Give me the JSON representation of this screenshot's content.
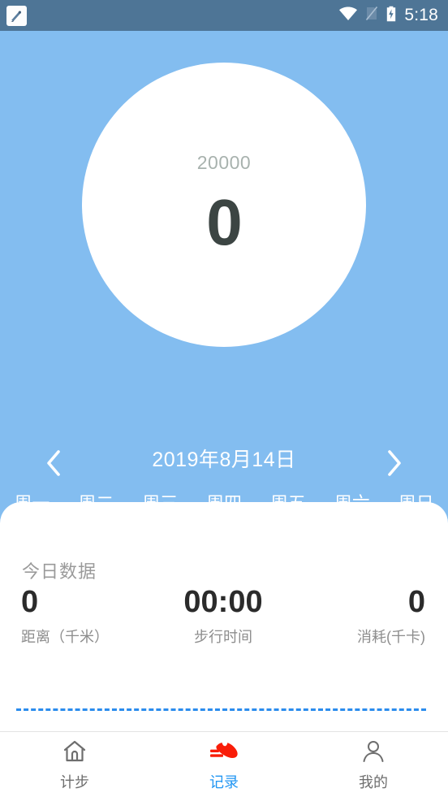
{
  "status_bar": {
    "time": "5:18",
    "background": "#4e7596",
    "icons": [
      "app-notification-icon",
      "wifi-icon",
      "sim-off-icon",
      "battery-charging-icon"
    ]
  },
  "theme": {
    "background": "#83bdf0",
    "card": "#ffffff",
    "accent_blue": "#2196f3",
    "step_value_color": "#3c4543",
    "goal_color": "#a8b2ae",
    "shoe_red": "#f91d08",
    "divider_blue": "#2b8ced"
  },
  "progress_ring": {
    "goal": "20000",
    "steps": "0"
  },
  "date_nav": {
    "prev_label": "prev-day",
    "date": "2019年8月14日",
    "next_label": "next-day"
  },
  "weekdays": [
    {
      "label": "周一"
    },
    {
      "label": "周二"
    },
    {
      "label": "周三"
    },
    {
      "label": "周四"
    },
    {
      "label": "周五"
    },
    {
      "label": "周六"
    },
    {
      "label": "周日"
    }
  ],
  "card": {
    "title": "今日数据",
    "stats": [
      {
        "value": "0",
        "label": "距离（千米）"
      },
      {
        "value": "00:00",
        "label": "步行时间"
      },
      {
        "value": "0",
        "label": "消耗(千卡)"
      }
    ]
  },
  "bottom_nav": {
    "items": [
      {
        "label": "计步",
        "icon": "home-icon",
        "active": false
      },
      {
        "label": "记录",
        "icon": "shoe-icon",
        "active": true
      },
      {
        "label": "我的",
        "icon": "person-icon",
        "active": false
      }
    ]
  }
}
